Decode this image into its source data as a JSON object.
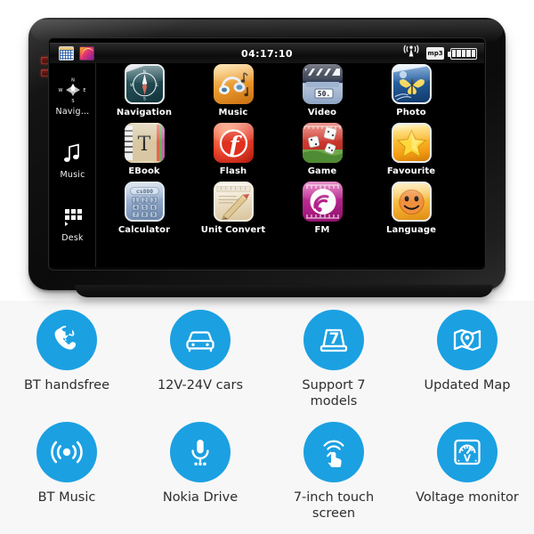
{
  "theme": {
    "badge_blue": "#1ba0e2",
    "panel_bg": "#f7f7f7",
    "page_bg": "#ffffff",
    "label_color": "#2e2e2e",
    "screen_bg": "#000000"
  },
  "device": {
    "name": "7-inch car GPS navigator",
    "statusbar": {
      "clock": "04:17:10",
      "left_icons": [
        "calendar-icon",
        "gallery-icon"
      ],
      "right_icons": [
        "wireless-signal-icon",
        "mp3-icon",
        "battery-icon"
      ],
      "mp3_label": "mp3",
      "battery_bars": 5
    },
    "sidebar": [
      {
        "label": "Navig…",
        "icon": "compass-icon"
      },
      {
        "label": "Music",
        "icon": "music-note-icon"
      },
      {
        "label": "Desk",
        "icon": "grid-apps-icon"
      }
    ],
    "apps": [
      {
        "label": "Navigation",
        "icon": "compass-app-icon"
      },
      {
        "label": "Music",
        "icon": "headphones-app-icon"
      },
      {
        "label": "Video",
        "icon": "clapperboard-app-icon",
        "badge": "50."
      },
      {
        "label": "Photo",
        "icon": "butterfly-photo-app-icon"
      },
      {
        "label": "EBook",
        "icon": "book-app-icon",
        "glyph": "T"
      },
      {
        "label": "Flash",
        "icon": "flash-app-icon",
        "glyph": "f"
      },
      {
        "label": "Game",
        "icon": "dice-app-icon"
      },
      {
        "label": "Favourite",
        "icon": "star-app-icon"
      },
      {
        "label": "Calculator",
        "icon": "calculator-app-icon",
        "display": "cs800",
        "keys": [
          "1",
          "2",
          "3",
          "4",
          "5",
          "6",
          "7",
          "8",
          "9"
        ]
      },
      {
        "label": "Unit  Convert",
        "icon": "ruler-pencil-app-icon"
      },
      {
        "label": "FM",
        "icon": "fm-radio-app-icon"
      },
      {
        "label": "Language",
        "icon": "smiley-app-icon"
      }
    ]
  },
  "features": [
    {
      "label": "BT handsfree",
      "icon": "phone-handset-icon"
    },
    {
      "label": "12V-24V cars",
      "icon": "car-icon"
    },
    {
      "label": "Support 7 models",
      "icon": "box-seven-icon"
    },
    {
      "label": "Updated Map",
      "icon": "map-pin-icon"
    },
    {
      "label": "BT Music",
      "icon": "broadcast-icon"
    },
    {
      "label": "Nokia Drive",
      "icon": "microphone-icon"
    },
    {
      "label": "7-inch touch screen",
      "icon": "touch-gesture-icon"
    },
    {
      "label": "Voltage monitor",
      "icon": "voltmeter-gauge-icon"
    }
  ]
}
